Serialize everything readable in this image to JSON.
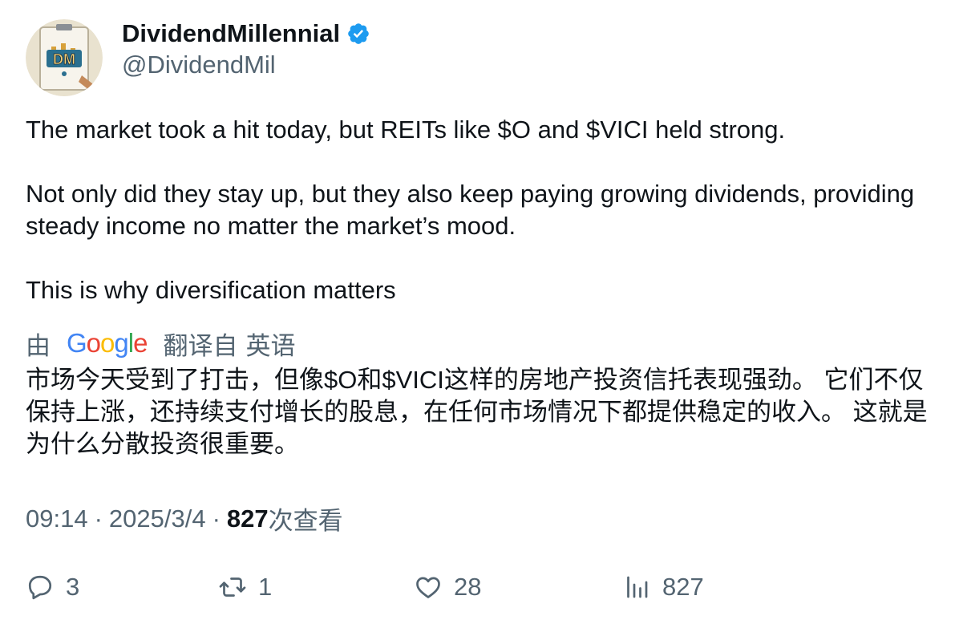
{
  "author": {
    "display_name": "DividendMillennial",
    "handle": "@DividendMil",
    "avatar_text": "DM",
    "verified_icon": "verified-badge-icon"
  },
  "tweet": {
    "paragraphs": [
      "The market took a hit today, but REITs like $O and $VICI held strong.",
      "Not only did they stay up, but they also keep paying growing dividends, providing steady income no matter the market’s mood.",
      "This is why diversification matters"
    ]
  },
  "translation": {
    "by_label": "由",
    "provider": "Google",
    "from_label": "翻译自",
    "language": "英语",
    "text": "市场今天受到了打击，但像$O和$VICI这样的房地产投资信托表现强劲。 它们不仅保持上涨，还持续支付增长的股息，在任何市场情况下都提供稳定的收入。 这就是为什么分散投资很重要。"
  },
  "meta": {
    "time": "09:14",
    "separator": "·",
    "date": "2025/3/4",
    "views_count": "827",
    "views_label": "次查看"
  },
  "actions": {
    "replies": "3",
    "reposts": "1",
    "likes": "28",
    "views": "827"
  },
  "colors": {
    "text": "#0f1419",
    "secondary": "#536471",
    "verified": "#1d9bf0",
    "google_blue": "#4285F4",
    "google_red": "#EA4335",
    "google_yellow": "#FBBC05",
    "google_green": "#34A853"
  }
}
